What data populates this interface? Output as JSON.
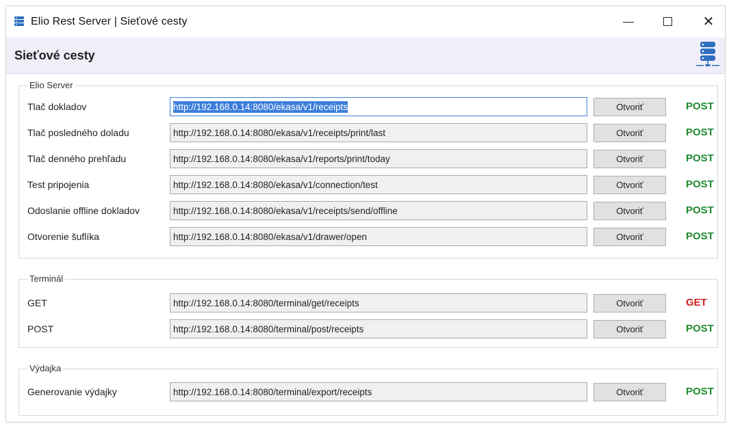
{
  "window": {
    "title": "Elio Rest Server | Sieťové cesty",
    "close_glyph": "✕"
  },
  "header": {
    "title": "Sieťové cesty"
  },
  "colors": {
    "post": "#1e8a2e",
    "get": "#cc1f1f",
    "header_bg": "#efeef9",
    "focus": "#3d7edb"
  },
  "groups": [
    {
      "label": "Elio Server",
      "rows": [
        {
          "label": "Tlač dokladov",
          "url": "http://192.168.0.14:8080/ekasa/v1/receipts",
          "button": "Otvoriť",
          "method": "POST"
        },
        {
          "label": "Tlač posledného doladu",
          "url": "http://192.168.0.14:8080/ekasa/v1/receipts/print/last",
          "button": "Otvoriť",
          "method": "POST"
        },
        {
          "label": "Tlač denného prehľadu",
          "url": "http://192.168.0.14:8080/ekasa/v1/reports/print/today",
          "button": "Otvoriť",
          "method": "POST"
        },
        {
          "label": "Test pripojenia",
          "url": "http://192.168.0.14:8080/ekasa/v1/connection/test",
          "button": "Otvoriť",
          "method": "POST"
        },
        {
          "label": "Odoslanie offline dokladov",
          "url": "http://192.168.0.14:8080/ekasa/v1/receipts/send/offline",
          "button": "Otvoriť",
          "method": "POST"
        },
        {
          "label": "Otvorenie šuflíka",
          "url": "http://192.168.0.14:8080/ekasa/v1/drawer/open",
          "button": "Otvoriť",
          "method": "POST"
        }
      ]
    },
    {
      "label": "Terminál",
      "rows": [
        {
          "label": "GET",
          "url": "http://192.168.0.14:8080/terminal/get/receipts",
          "button": "Otvoriť",
          "method": "GET"
        },
        {
          "label": "POST",
          "url": "http://192.168.0.14:8080/terminal/post/receipts",
          "button": "Otvoriť",
          "method": "POST"
        }
      ]
    },
    {
      "label": "Výdajka",
      "rows": [
        {
          "label": "Generovanie výdajky",
          "url": "http://192.168.0.14:8080/terminal/export/receipts",
          "button": "Otvoriť",
          "method": "POST"
        }
      ]
    }
  ]
}
